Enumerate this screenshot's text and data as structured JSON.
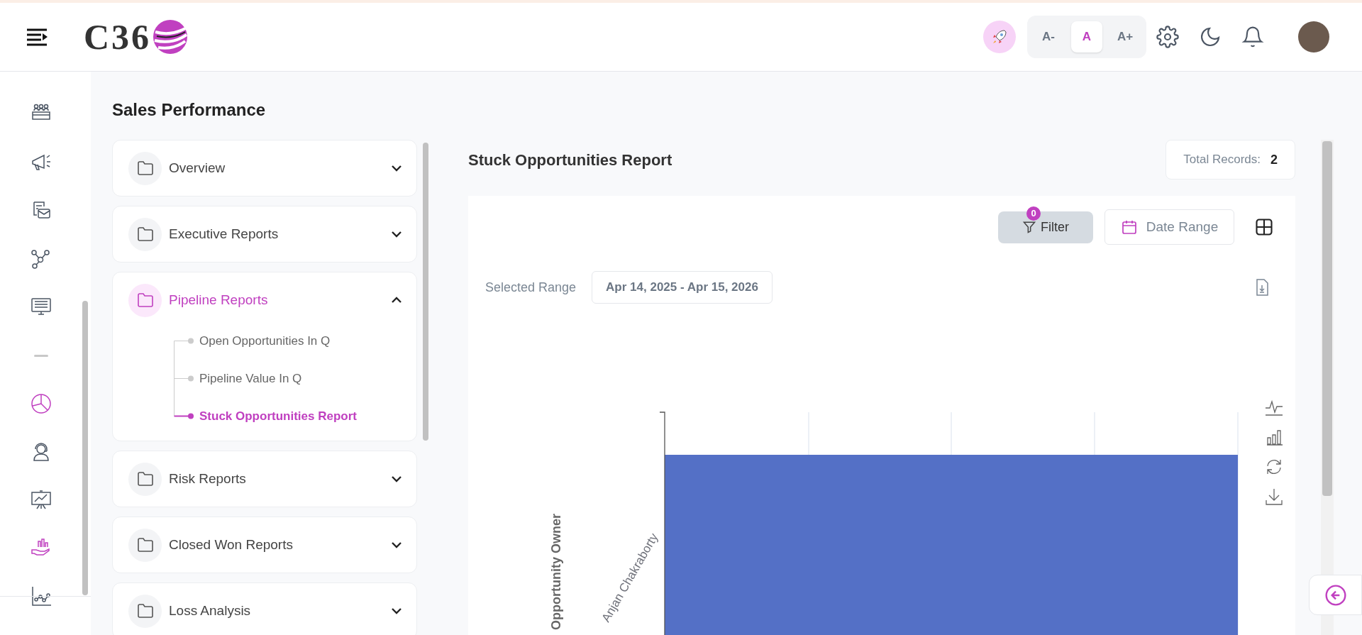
{
  "header": {
    "logo_text": "C36",
    "font_size_buttons": [
      {
        "label": "A-",
        "selected": false
      },
      {
        "label": "A",
        "selected": true
      },
      {
        "label": "A+",
        "selected": false
      }
    ]
  },
  "sidebar": {
    "items": [
      {
        "kind": "team",
        "highlighted": false
      },
      {
        "kind": "megaphone",
        "highlighted": false
      },
      {
        "kind": "mail",
        "highlighted": false
      },
      {
        "kind": "network",
        "highlighted": false
      },
      {
        "kind": "monitor",
        "highlighted": false
      },
      {
        "kind": "separator",
        "highlighted": false
      },
      {
        "kind": "pie",
        "highlighted": true
      },
      {
        "kind": "support",
        "highlighted": false
      },
      {
        "kind": "presentation",
        "highlighted": false
      },
      {
        "kind": "hand-chart",
        "highlighted": true
      },
      {
        "kind": "scatter",
        "highlighted": false
      }
    ]
  },
  "page_title": "Sales Performance",
  "report_groups": [
    {
      "label": "Overview",
      "expanded": false
    },
    {
      "label": "Executive Reports",
      "expanded": false
    },
    {
      "label": "Pipeline Reports",
      "expanded": true,
      "children": [
        {
          "label": "Open Opportunities In Q",
          "selected": false
        },
        {
          "label": "Pipeline Value In Q",
          "selected": false
        },
        {
          "label": "Stuck Opportunities Report",
          "selected": true
        }
      ]
    },
    {
      "label": "Risk Reports",
      "expanded": false
    },
    {
      "label": "Closed Won Reports",
      "expanded": false
    },
    {
      "label": "Loss Analysis",
      "expanded": false
    }
  ],
  "report": {
    "title": "Stuck Opportunities Report",
    "total_records": {
      "label": "Total Records:",
      "value": "2"
    },
    "filter": {
      "label": "Filter",
      "badge": "0"
    },
    "date_range": {
      "label": "Date Range"
    },
    "selected_range": {
      "label": "Selected Range",
      "value": "Apr 14, 2025 - Apr 15, 2026"
    },
    "chart": {
      "axis_title": "Opportunity Owner",
      "category_label": "Anjan Chakraborty"
    }
  }
}
